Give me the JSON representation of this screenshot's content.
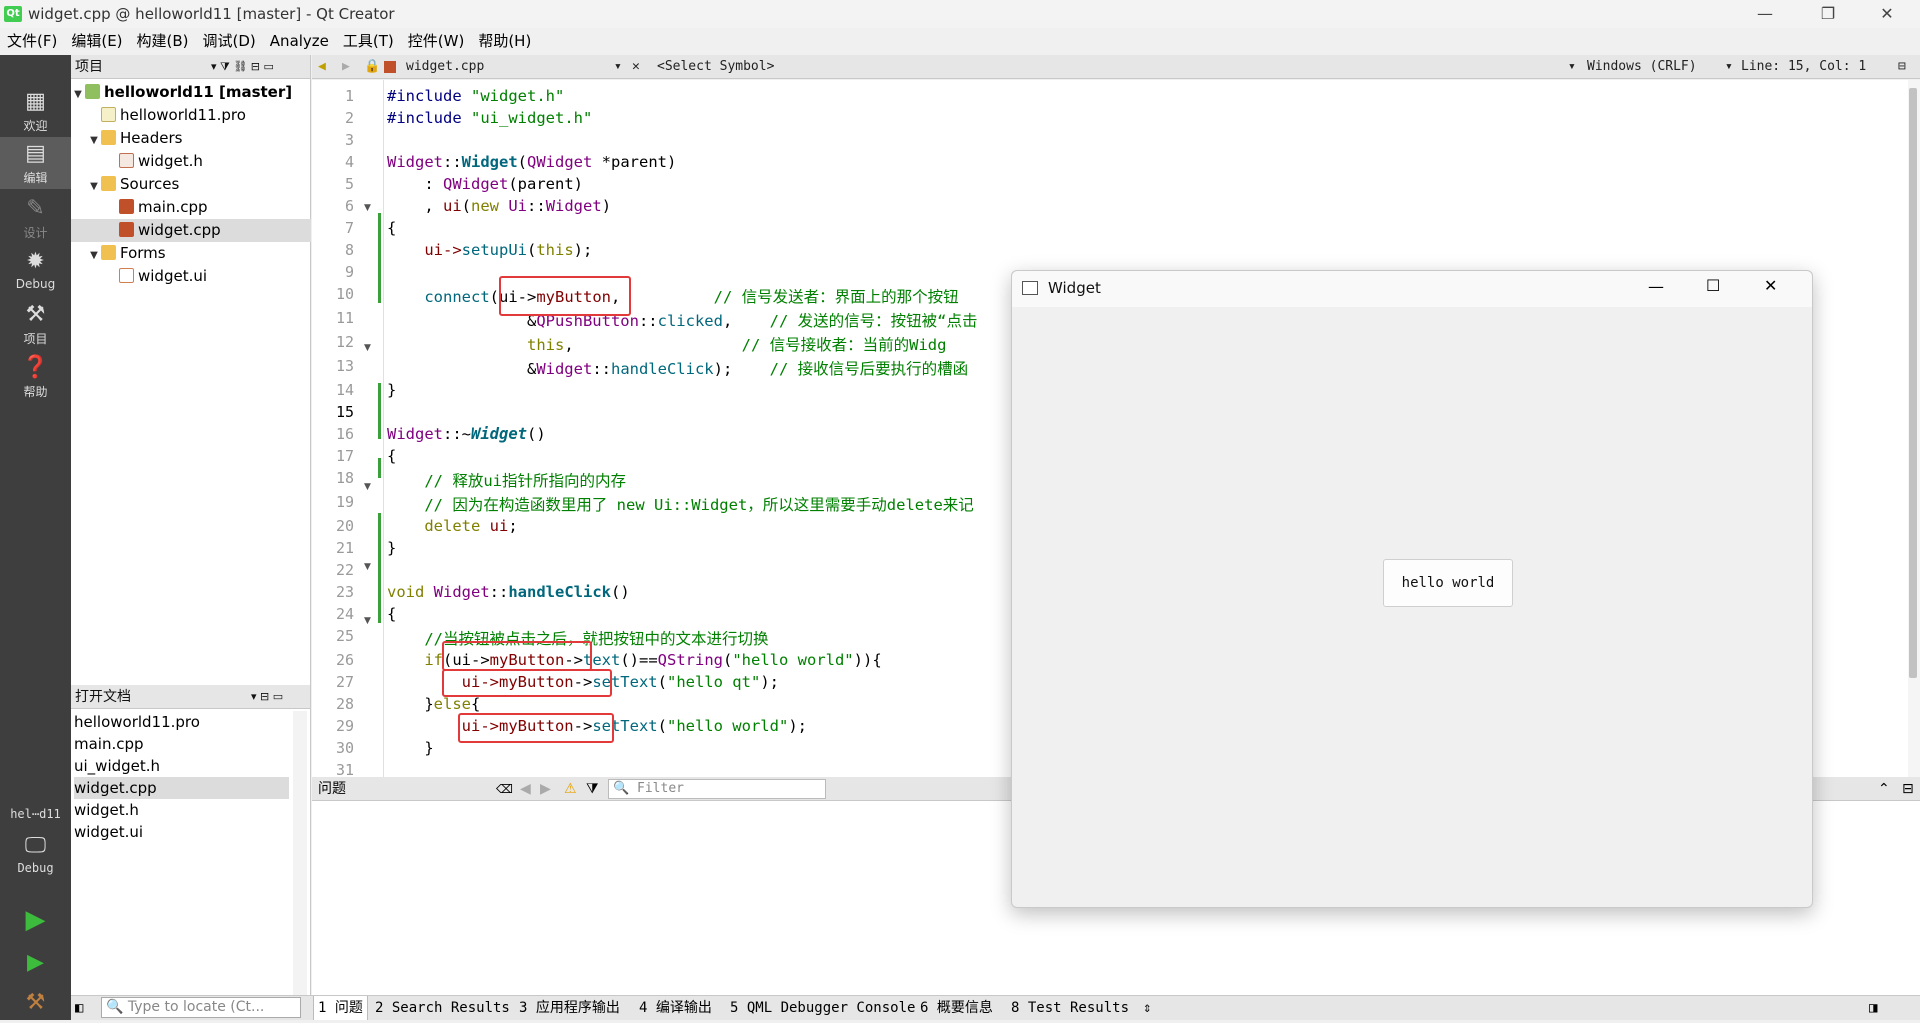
{
  "window": {
    "title": "widget.cpp @ helloworld11 [master] - Qt Creator"
  },
  "menu": [
    "文件(F)",
    "编辑(E)",
    "构建(B)",
    "调试(D)",
    "Analyze",
    "工具(T)",
    "控件(W)",
    "帮助(H)"
  ],
  "modes": {
    "welcome": "欢迎",
    "edit": "编辑",
    "design": "设计",
    "debug": "Debug",
    "projects": "项目",
    "help": "帮助"
  },
  "kit": {
    "project": "hel⋯d11",
    "config": "Debug"
  },
  "project_panel": {
    "title": "项目",
    "root": "helloworld11 [master]",
    "pro": "helloworld11.pro",
    "headers": "Headers",
    "widget_h": "widget.h",
    "sources": "Sources",
    "main_cpp": "main.cpp",
    "widget_cpp": "widget.cpp",
    "forms": "Forms",
    "widget_ui": "widget.ui"
  },
  "open_docs": {
    "title": "打开文档",
    "items": [
      "helloworld11.pro",
      "main.cpp",
      "ui_widget.h",
      "widget.cpp",
      "widget.h",
      "widget.ui"
    ]
  },
  "editor_toolbar": {
    "file": "widget.cpp",
    "symbol": "<Select Symbol>",
    "encoding": "Windows (CRLF)",
    "position": "Line: 15, Col: 1"
  },
  "line_numbers": [
    "1",
    "2",
    "3",
    "4",
    "5",
    "6",
    "7",
    "8",
    "9",
    "10",
    "11",
    "12",
    "13",
    "14",
    "15",
    "16",
    "17",
    "18",
    "19",
    "20",
    "21",
    "22",
    "23",
    "24",
    "25",
    "26",
    "27",
    "28",
    "29",
    "30",
    "31"
  ],
  "code": {
    "l1a": "#include ",
    "l1b": "\"widget.h\"",
    "l2a": "#include ",
    "l2b": "\"ui_widget.h\"",
    "l4a": "Widget",
    "l4b": "::",
    "l4c": "Widget",
    "l4d": "(",
    "l4e": "QWidget",
    "l4f": " *parent)",
    "l5a": "    : ",
    "l5b": "QWidget",
    "l5c": "(parent)",
    "l6a": "    , ",
    "l6b": "ui",
    "l6c": "(",
    "l6d": "new ",
    "l6e": "Ui",
    "l6f": "::",
    "l6g": "Widget",
    ")": ")",
    "l7": "{",
    "l8a": "    ui->",
    "l8b": "setupUi",
    "l8c": "(",
    "l8d": "this",
    "l8e": ");",
    "l10a": "    connect",
    "l10b": "(ui->",
    "l10c": "myButton",
    ",": ",",
    "l10d": "          // 信号发送者：界面上的那个按钮",
    "l11a": "               &",
    "l11b": "QPushButton",
    "l11c": "::",
    "l11d": "clicked",
    ",2": ",",
    "l11e": "    // 发送的信号：按钮被“点击",
    "l12a": "               ",
    "l12b": "this",
    ",3": ",",
    "l12c": "                  // 信号接收者：当前的Widg",
    "l13a": "               &",
    "l13b": "Widget",
    "l13c": "::",
    "l13d": "handleClick",
    ");": ");",
    "l13e": "    // 接收信号后要执行的槽函",
    "l14": "}",
    "l16a": "Widget",
    "l16b": "::~",
    "l16c": "Widget",
    "l16d": "()",
    "l17": "{",
    "l18": "    // 释放ui指针所指向的内存",
    "l19": "    // 因为在构造函数里用了 new Ui::Widget，所以这里需要手动delete来记",
    "l20a": "    ",
    "l20b": "delete ",
    "l20c": "ui",
    ";": ";",
    "l21": "}",
    "l23a": "void ",
    "l23b": "Widget",
    "l23c": "::",
    "l23d": "handleClick",
    "l23e": "()",
    "l24": "{",
    "l25": "    //当按钮被点击之后，就把按钮中的文本进行切换",
    "l26a": "    if",
    "l26b": "(ui->",
    "l26c": "myButton",
    "l26d": "->",
    "l26e": "text",
    "l26f": "()==",
    "l26g": "QString",
    "l26h": "(",
    "l26i": "\"hello world\"",
    "l26j": ")){",
    "l27a": "        ui->",
    "l27b": "myButton",
    "l27c": "->",
    "l27d": "setText",
    "l27e": "(",
    "l27f": "\"hello qt\"",
    "l27g": ");",
    "l28a": "    }",
    "l28b": "else",
    "l28c": "{",
    "l29a": "        ui->",
    "l29b": "myButton",
    "l29c": "->",
    "l29d": "setText",
    "l29e": "(",
    "l29f": "\"hello world\"",
    "l29g": ");",
    "l30": "    }"
  },
  "issues": {
    "title": "问题",
    "filter_placeholder": "Filter"
  },
  "bottom": {
    "locate_placeholder": "Type to locate (Ct...",
    "tabs": [
      "1 问题",
      "2 Search Results",
      "3 应用程序输出",
      "4 编译输出",
      "5 QML Debugger Console",
      "6 概要信息",
      "8 Test Results"
    ]
  },
  "widget_window": {
    "title": "Widget",
    "button": "hello world"
  }
}
